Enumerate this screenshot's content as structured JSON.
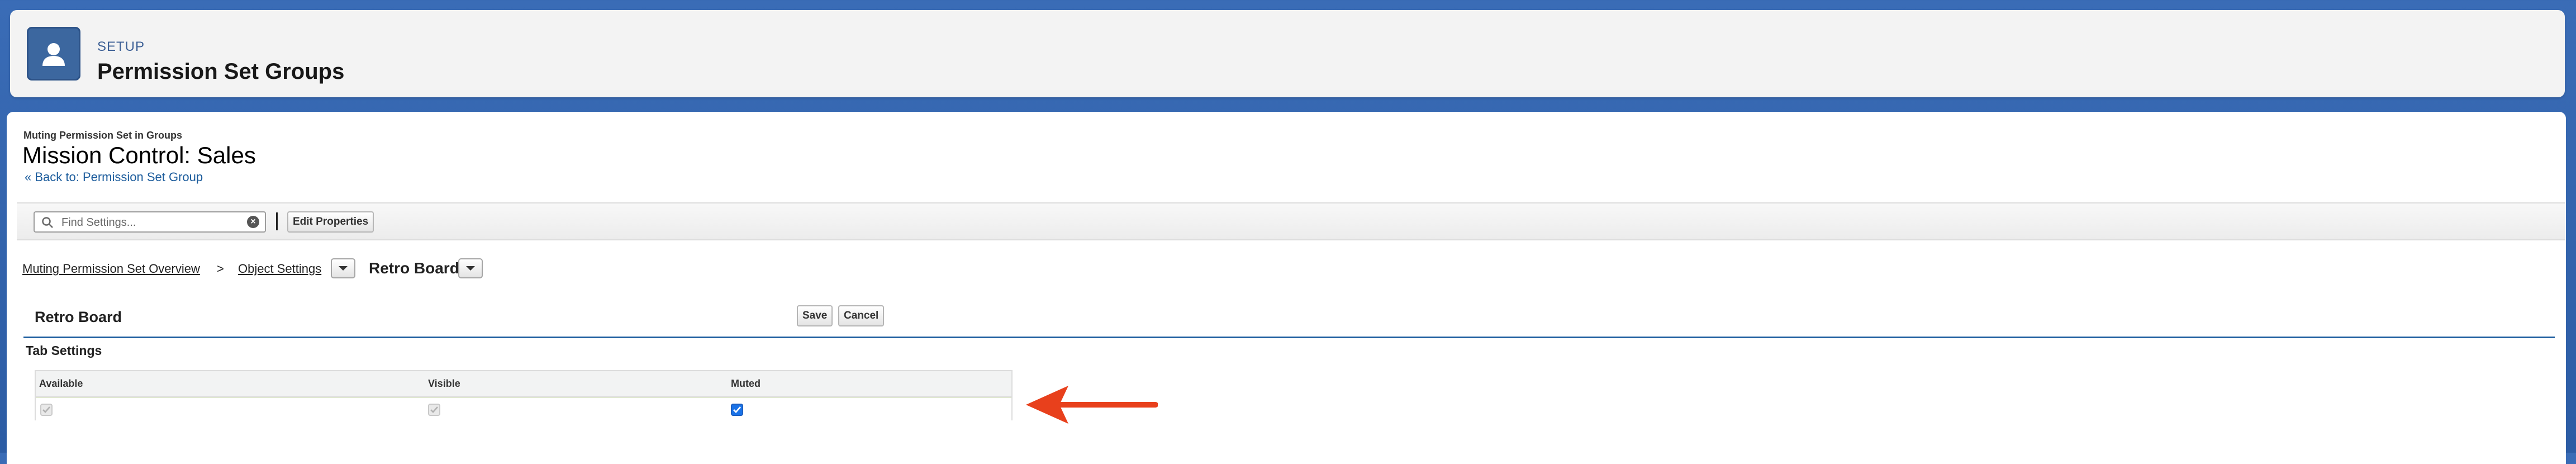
{
  "header": {
    "eyebrow": "SETUP",
    "title": "Permission Set Groups",
    "icon": "person-icon"
  },
  "page": {
    "eyebrow": "Muting Permission Set in Groups",
    "title": "Mission Control: Sales",
    "back_link": "« Back to: Permission Set Group"
  },
  "toolbar": {
    "search_placeholder": "Find Settings...",
    "edit_properties_label": "Edit Properties"
  },
  "breadcrumb": {
    "overview": "Muting Permission Set Overview",
    "separator": ">",
    "object_settings": "Object Settings",
    "current": "Retro Board"
  },
  "section": {
    "title": "Retro Board",
    "save_label": "Save",
    "cancel_label": "Cancel",
    "subtitle": "Tab Settings"
  },
  "tab_settings": {
    "columns": [
      "Available",
      "Visible",
      "Muted"
    ],
    "row": {
      "available": true,
      "visible": true,
      "muted": true
    }
  },
  "annotation": {
    "arrow_color": "#e8401c"
  }
}
